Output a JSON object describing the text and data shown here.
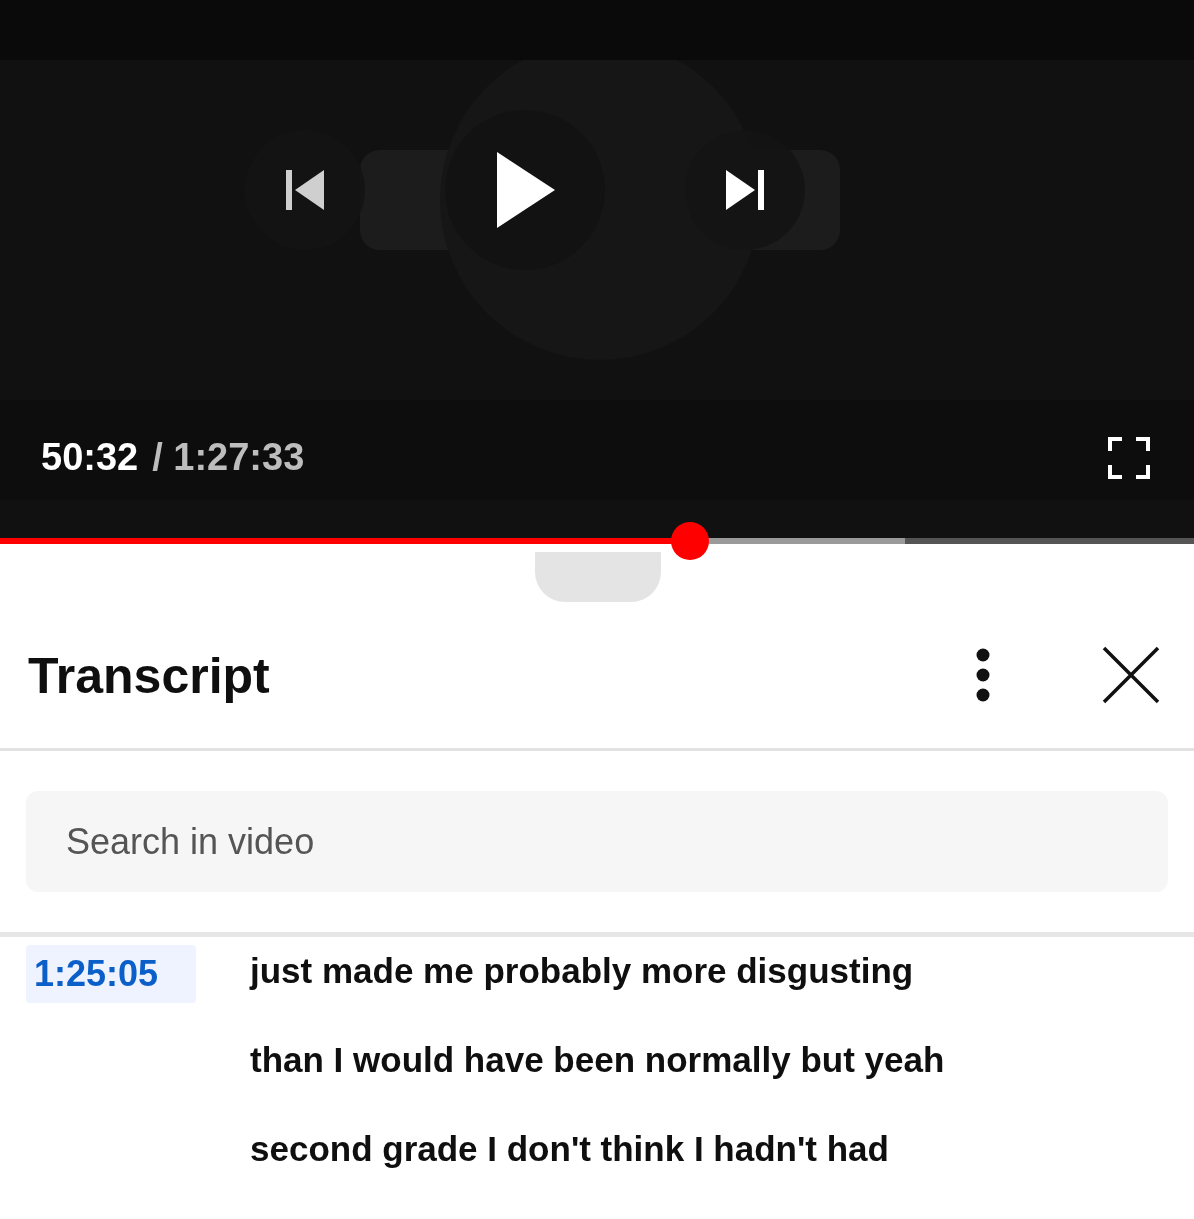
{
  "player": {
    "current_time": "50:32",
    "duration": "/ 1:27:33",
    "progress": {
      "level": 0.578
    },
    "buffered": {
      "level": 0.758
    }
  },
  "transcript": {
    "title": "Transcript",
    "search": {
      "placeholder": "Search in video"
    },
    "segments": [
      {
        "timestamp": "1:25:05",
        "selected": true,
        "lines": [
          "just made me probably more disgusting",
          "than I would have been normally but yeah",
          "second grade I don't think I hadn't had"
        ]
      }
    ]
  }
}
